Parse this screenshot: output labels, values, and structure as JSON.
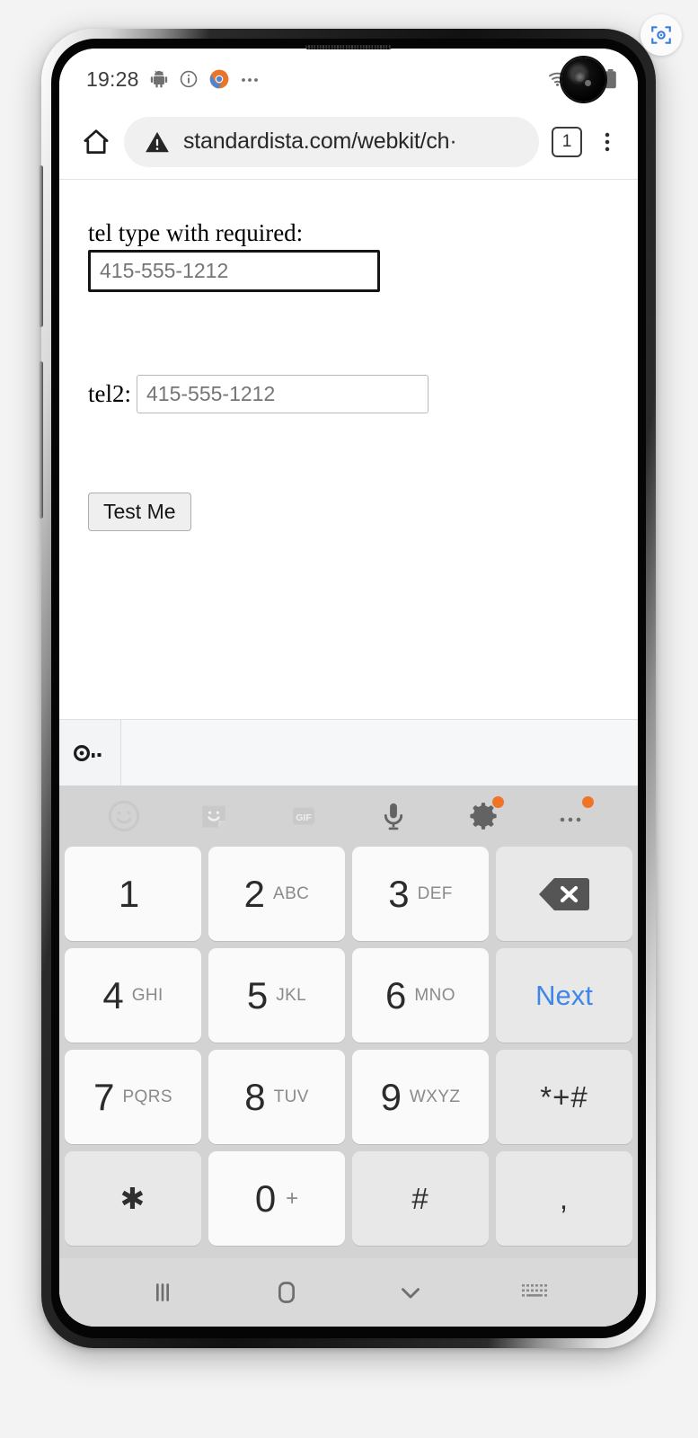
{
  "capture_badge": {
    "icon": "screenshot-capture-icon",
    "accent": "#3b7ddd"
  },
  "status_bar": {
    "time": "19:28",
    "left_icons": [
      "android-robot-icon",
      "info-circle-icon",
      "chrome-icon",
      "more-notifications-icon"
    ],
    "right_icons": [
      "wifi-icon",
      "cellular-signal-icon",
      "battery-icon"
    ]
  },
  "browser": {
    "home_icon": "home-icon",
    "security_icon": "not-secure-warning-icon",
    "url": "standardista.com/webkit/ch·",
    "tab_count": "1",
    "menu_icon": "overflow-menu-icon"
  },
  "page": {
    "tel1": {
      "label": "tel type with required:",
      "placeholder": "415-555-1212",
      "value": "",
      "focused": true
    },
    "tel2": {
      "label": "tel2:",
      "placeholder": "415-555-1212",
      "value": ""
    },
    "submit_label": "Test Me"
  },
  "autofill_bar": {
    "icon": "password-key-icon"
  },
  "keyboard": {
    "toolbar": [
      {
        "name": "emoji-icon",
        "badge": false
      },
      {
        "name": "sticker-icon",
        "badge": false
      },
      {
        "name": "gif-icon",
        "label": "GIF",
        "badge": false
      },
      {
        "name": "microphone-icon",
        "badge": false
      },
      {
        "name": "keyboard-settings-gear-icon",
        "badge": true
      },
      {
        "name": "keyboard-more-icon",
        "badge": true
      }
    ],
    "rows": [
      [
        {
          "digit": "1",
          "letters": "",
          "type": "digit"
        },
        {
          "digit": "2",
          "letters": "ABC",
          "type": "digit"
        },
        {
          "digit": "3",
          "letters": "DEF",
          "type": "digit"
        },
        {
          "digit": "",
          "letters": "",
          "type": "backspace",
          "name": "backspace-key"
        }
      ],
      [
        {
          "digit": "4",
          "letters": "GHI",
          "type": "digit"
        },
        {
          "digit": "5",
          "letters": "JKL",
          "type": "digit"
        },
        {
          "digit": "6",
          "letters": "MNO",
          "type": "digit"
        },
        {
          "digit": "",
          "letters": "",
          "type": "next",
          "label": "Next",
          "name": "next-key"
        }
      ],
      [
        {
          "digit": "7",
          "letters": "PQRS",
          "type": "digit"
        },
        {
          "digit": "8",
          "letters": "TUV",
          "type": "digit"
        },
        {
          "digit": "9",
          "letters": "WXYZ",
          "type": "digit"
        },
        {
          "digit": "",
          "letters": "",
          "type": "symbol",
          "label": "*+#",
          "name": "symbols-key"
        }
      ],
      [
        {
          "digit": "",
          "letters": "",
          "type": "symbol",
          "label": "✱",
          "name": "asterisk-key"
        },
        {
          "digit": "0",
          "letters": "+",
          "type": "zero"
        },
        {
          "digit": "",
          "letters": "",
          "type": "symbol",
          "label": "#",
          "name": "hash-key"
        },
        {
          "digit": "",
          "letters": "",
          "type": "symbol",
          "label": ",",
          "name": "comma-key"
        }
      ]
    ],
    "next_key_color": "#3e87e8"
  },
  "nav_bar": {
    "items": [
      {
        "name": "recents-button",
        "icon": "recents-icon"
      },
      {
        "name": "home-button",
        "icon": "home-square-icon"
      },
      {
        "name": "hide-keyboard-button",
        "icon": "chevron-down-icon"
      },
      {
        "name": "switch-keyboard-button",
        "icon": "keyboard-switch-icon"
      }
    ]
  }
}
